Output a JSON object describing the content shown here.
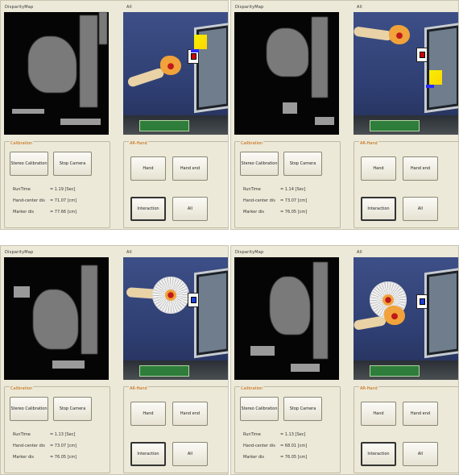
{
  "panels": [
    {
      "disparity_title": "DisparityMap",
      "camera_title": "All",
      "calibration": {
        "title": "Calibration",
        "stereo_label": "Stereo Calibration",
        "stop_label": "Stop Camera"
      },
      "ar_hand": {
        "title": "AR-Hand",
        "hand_label": "Hand",
        "hand_end_label": "Hand end",
        "interaction_label": "Interaction",
        "all_label": "All"
      },
      "metrics": [
        {
          "label": "RunTime",
          "value": "= 1.19 [Sec]"
        },
        {
          "label": "Hand-center dis",
          "value": "= 71.07 [cm]"
        },
        {
          "label": "Marker dis",
          "value": "= 77.66 [cm]"
        }
      ]
    },
    {
      "disparity_title": "DisparityMap",
      "camera_title": "All",
      "calibration": {
        "title": "Calibration",
        "stereo_label": "Stereo Calibration",
        "stop_label": "Stop Camera"
      },
      "ar_hand": {
        "title": "AR-Hand",
        "hand_label": "Hand",
        "hand_end_label": "Hand end",
        "interaction_label": "Interaction",
        "all_label": "All"
      },
      "metrics": [
        {
          "label": "RunTime",
          "value": "= 1.14 [Sec]"
        },
        {
          "label": "Hand-center dis",
          "value": "= 73.07 [cm]"
        },
        {
          "label": "Marker dis",
          "value": "= 76.05 [cm]"
        }
      ]
    },
    {
      "disparity_title": "DisparityMap",
      "camera_title": "All",
      "calibration": {
        "title": "Calibration",
        "stereo_label": "Stereo Calibration",
        "stop_label": "Stop Camera"
      },
      "ar_hand": {
        "title": "AR-Hand",
        "hand_label": "Hand",
        "hand_end_label": "Hand end",
        "interaction_label": "Interaction",
        "all_label": "All"
      },
      "metrics": [
        {
          "label": "RunTime",
          "value": "= 1.13 [Sec]"
        },
        {
          "label": "Hand-center dis",
          "value": "= 73.07 [cm]"
        },
        {
          "label": "Marker dis",
          "value": "= 76.05 [cm]"
        }
      ]
    },
    {
      "disparity_title": "DisparityMap",
      "camera_title": "All",
      "calibration": {
        "title": "Calibration",
        "stereo_label": "Stereo Calibration",
        "stop_label": "Stop Camera"
      },
      "ar_hand": {
        "title": "AR-Hand",
        "hand_label": "Hand",
        "hand_end_label": "Hand end",
        "interaction_label": "Interaction",
        "all_label": "All"
      },
      "metrics": [
        {
          "label": "RunTime",
          "value": "= 1.13 [Sec]"
        },
        {
          "label": "Hand-center dis",
          "value": "= 68.01 [cm]"
        },
        {
          "label": "Marker dis",
          "value": "= 76.05 [cm]"
        }
      ]
    }
  ]
}
